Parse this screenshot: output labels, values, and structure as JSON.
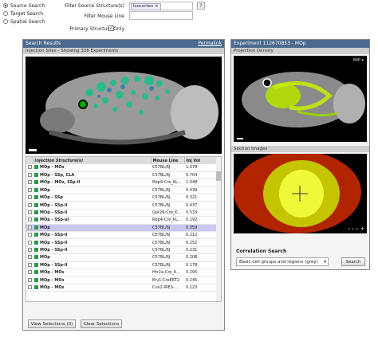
{
  "search_modes": [
    {
      "label": "Source Search",
      "checked": true
    },
    {
      "label": "Target Search",
      "checked": false
    },
    {
      "label": "Spatial Search",
      "checked": false
    }
  ],
  "form": {
    "source_label": "Filter Source Structure(s)",
    "source_token": "Isocortex",
    "mouse_label": "Filter Mouse Line",
    "mouse_value": "",
    "primary_label": "Primary Structure Only",
    "help": "?"
  },
  "results": {
    "title": "Search Results",
    "permalink": "Permalink",
    "injection_header": "Injection Sites - Showing 328 Experiments",
    "columns": [
      "Injection Structure(s)",
      "Mouse Line",
      "Inj Vol"
    ],
    "rows": [
      {
        "structure": "MOp - MOs",
        "line": "C57BL/6J",
        "vol": "1.078"
      },
      {
        "structure": "MOp - SSp, CLA",
        "line": "C57BL/6J",
        "vol": "0.704"
      },
      {
        "structure": "MOp - MOs, SSp-ll",
        "line": "Rbp4-Cre_KL...",
        "vol": "1.048"
      },
      {
        "structure": "MOp",
        "line": "C57BL/6J",
        "vol": "0.439"
      },
      {
        "structure": "MOp - SSp",
        "line": "C57BL/6J",
        "vol": "0.321"
      },
      {
        "structure": "MOp - SSp-ll",
        "line": "C57BL/6J",
        "vol": "0.437"
      },
      {
        "structure": "MOp - SSp-ll",
        "line": "Gpr26-Cre_K...",
        "vol": "0.533"
      },
      {
        "structure": "MOp - SSp-ul",
        "line": "Rbp4-Cre_KL...",
        "vol": "0.292"
      },
      {
        "structure": "MOp",
        "line": "C57BL/6J",
        "vol": "0.359"
      },
      {
        "structure": "MOp - SSp-ll",
        "line": "C57BL/6J",
        "vol": "0.212"
      },
      {
        "structure": "MOp - SSp-ll",
        "line": "C57BL/6J",
        "vol": "0.252"
      },
      {
        "structure": "MOp - SSp-ll",
        "line": "C57BL/6J",
        "vol": "0.231"
      },
      {
        "structure": "MOp",
        "line": "C57BL/6J",
        "vol": "0.208"
      },
      {
        "structure": "MOp - SSp-ll",
        "line": "C57BL/6J",
        "vol": "0.178"
      },
      {
        "structure": "MOp - MOs",
        "line": "Htr2a-Cre_K...",
        "vol": "0.205"
      },
      {
        "structure": "MOp - MOs",
        "line": "Etv1-CreERT2",
        "vol": "0.245"
      },
      {
        "structure": "MOp - MOs",
        "line": "Cux2-IRES-...",
        "vol": "0.123"
      }
    ],
    "selected_row": 8,
    "view_button": "View Selections (0)",
    "clear_button": "Clear Selections"
  },
  "experiment": {
    "title": "Experiment 112670853 - MOp",
    "projection_header": "Projection Density",
    "mip_label": "MIP",
    "section_header": "Section Images",
    "correlation_title": "Correlation Search",
    "correlation_select": "Basic cell groups and regions (grey)",
    "search_button": "Search"
  },
  "colors": {
    "panel_header": "#4a6a8e",
    "structure_swatch": "#2a9a46",
    "selected_row": "#c8c8f0"
  },
  "icons": [
    "dropdown-arrow-icon",
    "scrollbar",
    "prev-icon",
    "next-icon",
    "zoom-icon"
  ]
}
